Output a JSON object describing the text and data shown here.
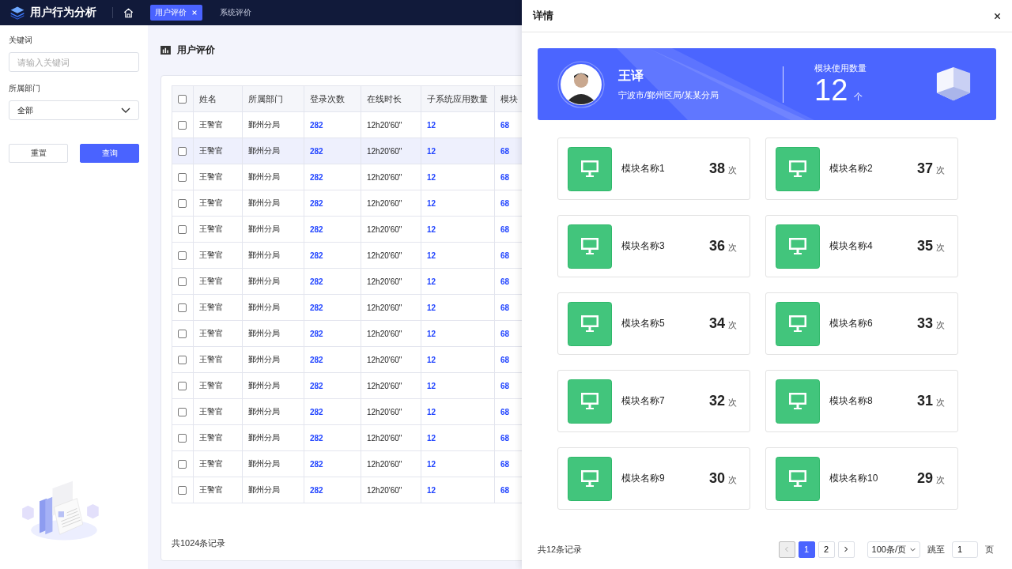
{
  "app": {
    "title": "用户行为分析"
  },
  "tabs": [
    {
      "label": "用户评价",
      "selected": true,
      "closable": true
    },
    {
      "label": "系统评价",
      "selected": false,
      "closable": false
    }
  ],
  "filters": {
    "keyword": {
      "label": "关键词",
      "placeholder": "请输入关键词"
    },
    "department": {
      "label": "所属部门",
      "value": "全部"
    },
    "buttons": [
      {
        "label": "重置",
        "kind": "secondary"
      },
      {
        "label": "查询",
        "kind": "primary"
      }
    ]
  },
  "panel": {
    "title": "用户评价",
    "table": {
      "header_checked": false,
      "columns": [
        {
          "label": "姓名",
          "kind": "text"
        },
        {
          "label": "所属部门",
          "kind": "text"
        },
        {
          "label": "登录次数",
          "kind": "number"
        },
        {
          "label": "在线时长",
          "kind": "text"
        },
        {
          "label": "子系统应用数量",
          "kind": "number"
        },
        {
          "label": "模块",
          "kind": "number"
        }
      ],
      "rows": [
        {
          "selected": false,
          "checked": false,
          "cells": [
            "王警官",
            "鄞州分局",
            "282",
            "12h20'60\"",
            "12",
            "68"
          ]
        },
        {
          "selected": true,
          "checked": false,
          "cells": [
            "王警官",
            "鄞州分局",
            "282",
            "12h20'60\"",
            "12",
            "68"
          ]
        },
        {
          "selected": false,
          "checked": false,
          "cells": [
            "王警官",
            "鄞州分局",
            "282",
            "12h20'60\"",
            "12",
            "68"
          ]
        },
        {
          "selected": false,
          "checked": false,
          "cells": [
            "王警官",
            "鄞州分局",
            "282",
            "12h20'60\"",
            "12",
            "68"
          ]
        },
        {
          "selected": false,
          "checked": false,
          "cells": [
            "王警官",
            "鄞州分局",
            "282",
            "12h20'60\"",
            "12",
            "68"
          ]
        },
        {
          "selected": false,
          "checked": false,
          "cells": [
            "王警官",
            "鄞州分局",
            "282",
            "12h20'60\"",
            "12",
            "68"
          ]
        },
        {
          "selected": false,
          "checked": false,
          "cells": [
            "王警官",
            "鄞州分局",
            "282",
            "12h20'60\"",
            "12",
            "68"
          ]
        },
        {
          "selected": false,
          "checked": false,
          "cells": [
            "王警官",
            "鄞州分局",
            "282",
            "12h20'60\"",
            "12",
            "68"
          ]
        },
        {
          "selected": false,
          "checked": false,
          "cells": [
            "王警官",
            "鄞州分局",
            "282",
            "12h20'60\"",
            "12",
            "68"
          ]
        },
        {
          "selected": false,
          "checked": false,
          "cells": [
            "王警官",
            "鄞州分局",
            "282",
            "12h20'60\"",
            "12",
            "68"
          ]
        },
        {
          "selected": false,
          "checked": false,
          "cells": [
            "王警官",
            "鄞州分局",
            "282",
            "12h20'60\"",
            "12",
            "68"
          ]
        },
        {
          "selected": false,
          "checked": false,
          "cells": [
            "王警官",
            "鄞州分局",
            "282",
            "12h20'60\"",
            "12",
            "68"
          ]
        },
        {
          "selected": false,
          "checked": false,
          "cells": [
            "王警官",
            "鄞州分局",
            "282",
            "12h20'60\"",
            "12",
            "68"
          ]
        },
        {
          "selected": false,
          "checked": false,
          "cells": [
            "王警官",
            "鄞州分局",
            "282",
            "12h20'60\"",
            "12",
            "68"
          ]
        },
        {
          "selected": false,
          "checked": false,
          "cells": [
            "王警官",
            "鄞州分局",
            "282",
            "12h20'60\"",
            "12",
            "68"
          ]
        }
      ]
    },
    "total": "共1024条记录"
  },
  "drawer": {
    "title": "详情",
    "user": {
      "name": "王译",
      "org": "宁波市/鄞州区局/某某分局"
    },
    "stat": {
      "label": "模块使用数量",
      "value": "12",
      "unit": "个"
    },
    "modules": [
      {
        "name": "模块名称1",
        "count": "38",
        "unit": "次"
      },
      {
        "name": "模块名称2",
        "count": "37",
        "unit": "次"
      },
      {
        "name": "模块名称3",
        "count": "36",
        "unit": "次"
      },
      {
        "name": "模块名称4",
        "count": "35",
        "unit": "次"
      },
      {
        "name": "模块名称5",
        "count": "34",
        "unit": "次"
      },
      {
        "name": "模块名称6",
        "count": "33",
        "unit": "次"
      },
      {
        "name": "模块名称7",
        "count": "32",
        "unit": "次"
      },
      {
        "name": "模块名称8",
        "count": "31",
        "unit": "次"
      },
      {
        "name": "模块名称9",
        "count": "30",
        "unit": "次"
      },
      {
        "name": "模块名称10",
        "count": "29",
        "unit": "次"
      }
    ],
    "footer": {
      "total": "共12条记录",
      "prev_disabled": true,
      "pages": [
        {
          "label": "1",
          "selected": true
        },
        {
          "label": "2",
          "selected": false
        }
      ],
      "page_size": "100条/页",
      "jump_label": "跳至",
      "jump_value": "1",
      "jump_suffix": "页"
    }
  }
}
